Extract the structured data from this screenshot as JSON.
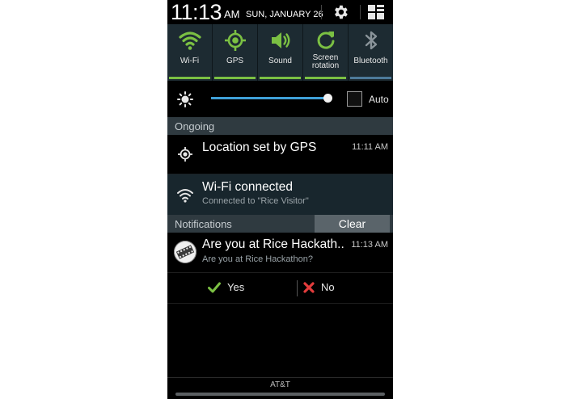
{
  "status_bar": {
    "time": "11:13",
    "ampm": "AM",
    "date": "SUN, JANUARY 26",
    "settings_icon": "gear-icon",
    "panel_icon": "quick-panel-grid-icon"
  },
  "toggles": [
    {
      "label": "Wi-Fi",
      "icon": "wifi-icon",
      "state": "on"
    },
    {
      "label": "GPS",
      "icon": "gps-icon",
      "state": "on"
    },
    {
      "label": "Sound",
      "icon": "sound-icon",
      "state": "on"
    },
    {
      "label": "Screen\nrotation",
      "icon": "rotation-icon",
      "state": "on"
    },
    {
      "label": "Bluetooth",
      "icon": "bluetooth-icon",
      "state": "off"
    }
  ],
  "brightness": {
    "level": 0.97,
    "auto_label": "Auto",
    "auto_checked": false
  },
  "ongoing": {
    "header": "Ongoing",
    "items": [
      {
        "title": "Location set by GPS",
        "time": "11:11 AM"
      },
      {
        "title": "Wi-Fi connected",
        "subtitle": "Connected to \"Rice Visitor\""
      }
    ]
  },
  "notifications": {
    "header": "Notifications",
    "clear_label": "Clear",
    "items": [
      {
        "title": "Are you at Rice Hackath..",
        "subtitle": "Are you at Rice Hackathon?",
        "time": "11:13 AM"
      }
    ],
    "actions": {
      "yes_label": "Yes",
      "no_label": "No"
    }
  },
  "carrier": "AT&T",
  "colors": {
    "accent_green": "#7bc043",
    "toggle_bg": "#1d2b32",
    "slider_blue": "#3fa0d8",
    "bluetooth_off": "#4d7a99",
    "no_red": "#e23c3c"
  }
}
